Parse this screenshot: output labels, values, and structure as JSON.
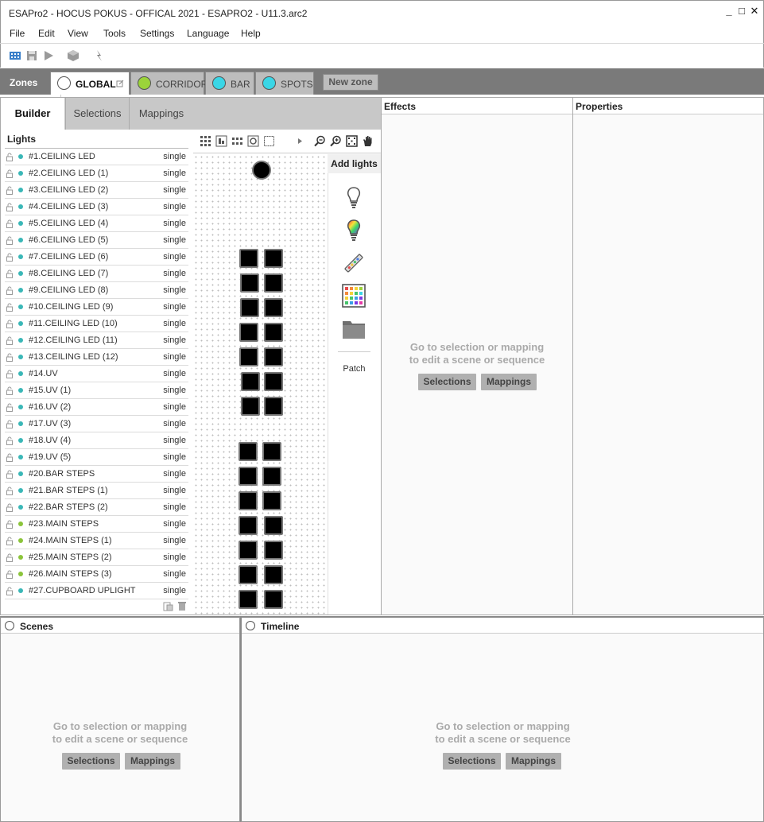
{
  "window": {
    "title": "ESAPro2 - HOCUS POKUS - OFFICAL 2021 - ESAPRO2 - U11.3.arc2",
    "minimize": "_",
    "maximize": "□",
    "close": "✕"
  },
  "menu": [
    "File",
    "Edit",
    "View",
    "Tools",
    "Settings",
    "Language",
    "Help"
  ],
  "zones": {
    "label": "Zones",
    "tabs": [
      {
        "label": "GLOBAL",
        "color": "#ffffff",
        "active": true
      },
      {
        "label": "CORRIDOR",
        "color": "#9bd33a",
        "active": false
      },
      {
        "label": "BAR",
        "color": "#3ad6e6",
        "active": false
      },
      {
        "label": "SPOTS",
        "color": "#3ad6e6",
        "active": false
      }
    ],
    "new_zone": "New zone"
  },
  "builder": {
    "tabs": [
      "Builder",
      "Selections",
      "Mappings"
    ],
    "lights_title": "Lights",
    "lights": [
      {
        "name": "#1.CEILING LED",
        "type": "single",
        "color": "#3ab7b7"
      },
      {
        "name": "#2.CEILING LED (1)",
        "type": "single",
        "color": "#3ab7b7"
      },
      {
        "name": "#3.CEILING LED (2)",
        "type": "single",
        "color": "#3ab7b7"
      },
      {
        "name": "#4.CEILING LED (3)",
        "type": "single",
        "color": "#3ab7b7"
      },
      {
        "name": "#5.CEILING LED (4)",
        "type": "single",
        "color": "#3ab7b7"
      },
      {
        "name": "#6.CEILING LED (5)",
        "type": "single",
        "color": "#3ab7b7"
      },
      {
        "name": "#7.CEILING LED (6)",
        "type": "single",
        "color": "#3ab7b7"
      },
      {
        "name": "#8.CEILING LED (7)",
        "type": "single",
        "color": "#3ab7b7"
      },
      {
        "name": "#9.CEILING LED (8)",
        "type": "single",
        "color": "#3ab7b7"
      },
      {
        "name": "#10.CEILING LED (9)",
        "type": "single",
        "color": "#3ab7b7"
      },
      {
        "name": "#11.CEILING LED (10)",
        "type": "single",
        "color": "#3ab7b7"
      },
      {
        "name": "#12.CEILING LED (11)",
        "type": "single",
        "color": "#3ab7b7"
      },
      {
        "name": "#13.CEILING LED (12)",
        "type": "single",
        "color": "#3ab7b7"
      },
      {
        "name": "#14.UV",
        "type": "single",
        "color": "#3ab7b7"
      },
      {
        "name": "#15.UV (1)",
        "type": "single",
        "color": "#3ab7b7"
      },
      {
        "name": "#16.UV (2)",
        "type": "single",
        "color": "#3ab7b7"
      },
      {
        "name": "#17.UV (3)",
        "type": "single",
        "color": "#3ab7b7"
      },
      {
        "name": "#18.UV (4)",
        "type": "single",
        "color": "#3ab7b7"
      },
      {
        "name": "#19.UV (5)",
        "type": "single",
        "color": "#3ab7b7"
      },
      {
        "name": "#20.BAR STEPS",
        "type": "single",
        "color": "#3ab7b7"
      },
      {
        "name": "#21.BAR STEPS (1)",
        "type": "single",
        "color": "#3ab7b7"
      },
      {
        "name": "#22.BAR STEPS (2)",
        "type": "single",
        "color": "#3ab7b7"
      },
      {
        "name": "#23.MAIN STEPS",
        "type": "single",
        "color": "#8bc43a"
      },
      {
        "name": "#24.MAIN STEPS (1)",
        "type": "single",
        "color": "#8bc43a"
      },
      {
        "name": "#25.MAIN STEPS (2)",
        "type": "single",
        "color": "#8bc43a"
      },
      {
        "name": "#26.MAIN STEPS (3)",
        "type": "single",
        "color": "#8bc43a"
      },
      {
        "name": "#27.CUPBOARD UPLIGHT",
        "type": "single",
        "color": "#3ab7b7"
      }
    ],
    "add_lights_title": "Add lights",
    "patch_label": "Patch"
  },
  "panels": {
    "effects_title": "Effects",
    "properties_title": "Properties",
    "scenes_title": "Scenes",
    "timeline_title": "Timeline",
    "hint_line1": "Go to selection or mapping",
    "hint_line2": "to edit a scene or sequence",
    "selections_btn": "Selections",
    "mappings_btn": "Mappings"
  },
  "icons": {
    "toolbar": [
      "dmx-icon",
      "save-icon",
      "play-icon",
      "cube-icon",
      "pointer-icon"
    ],
    "canvas": [
      "grid-icon",
      "align-icon",
      "distribute-icon",
      "rotate-icon",
      "select-box-icon",
      "play-small-icon",
      "zoom-out-icon",
      "zoom-in-icon",
      "fit-icon",
      "hand-icon"
    ],
    "add_lights": [
      "bulb-icon",
      "rgb-bulb-icon",
      "led-strip-icon",
      "matrix-icon",
      "folder-icon"
    ]
  }
}
